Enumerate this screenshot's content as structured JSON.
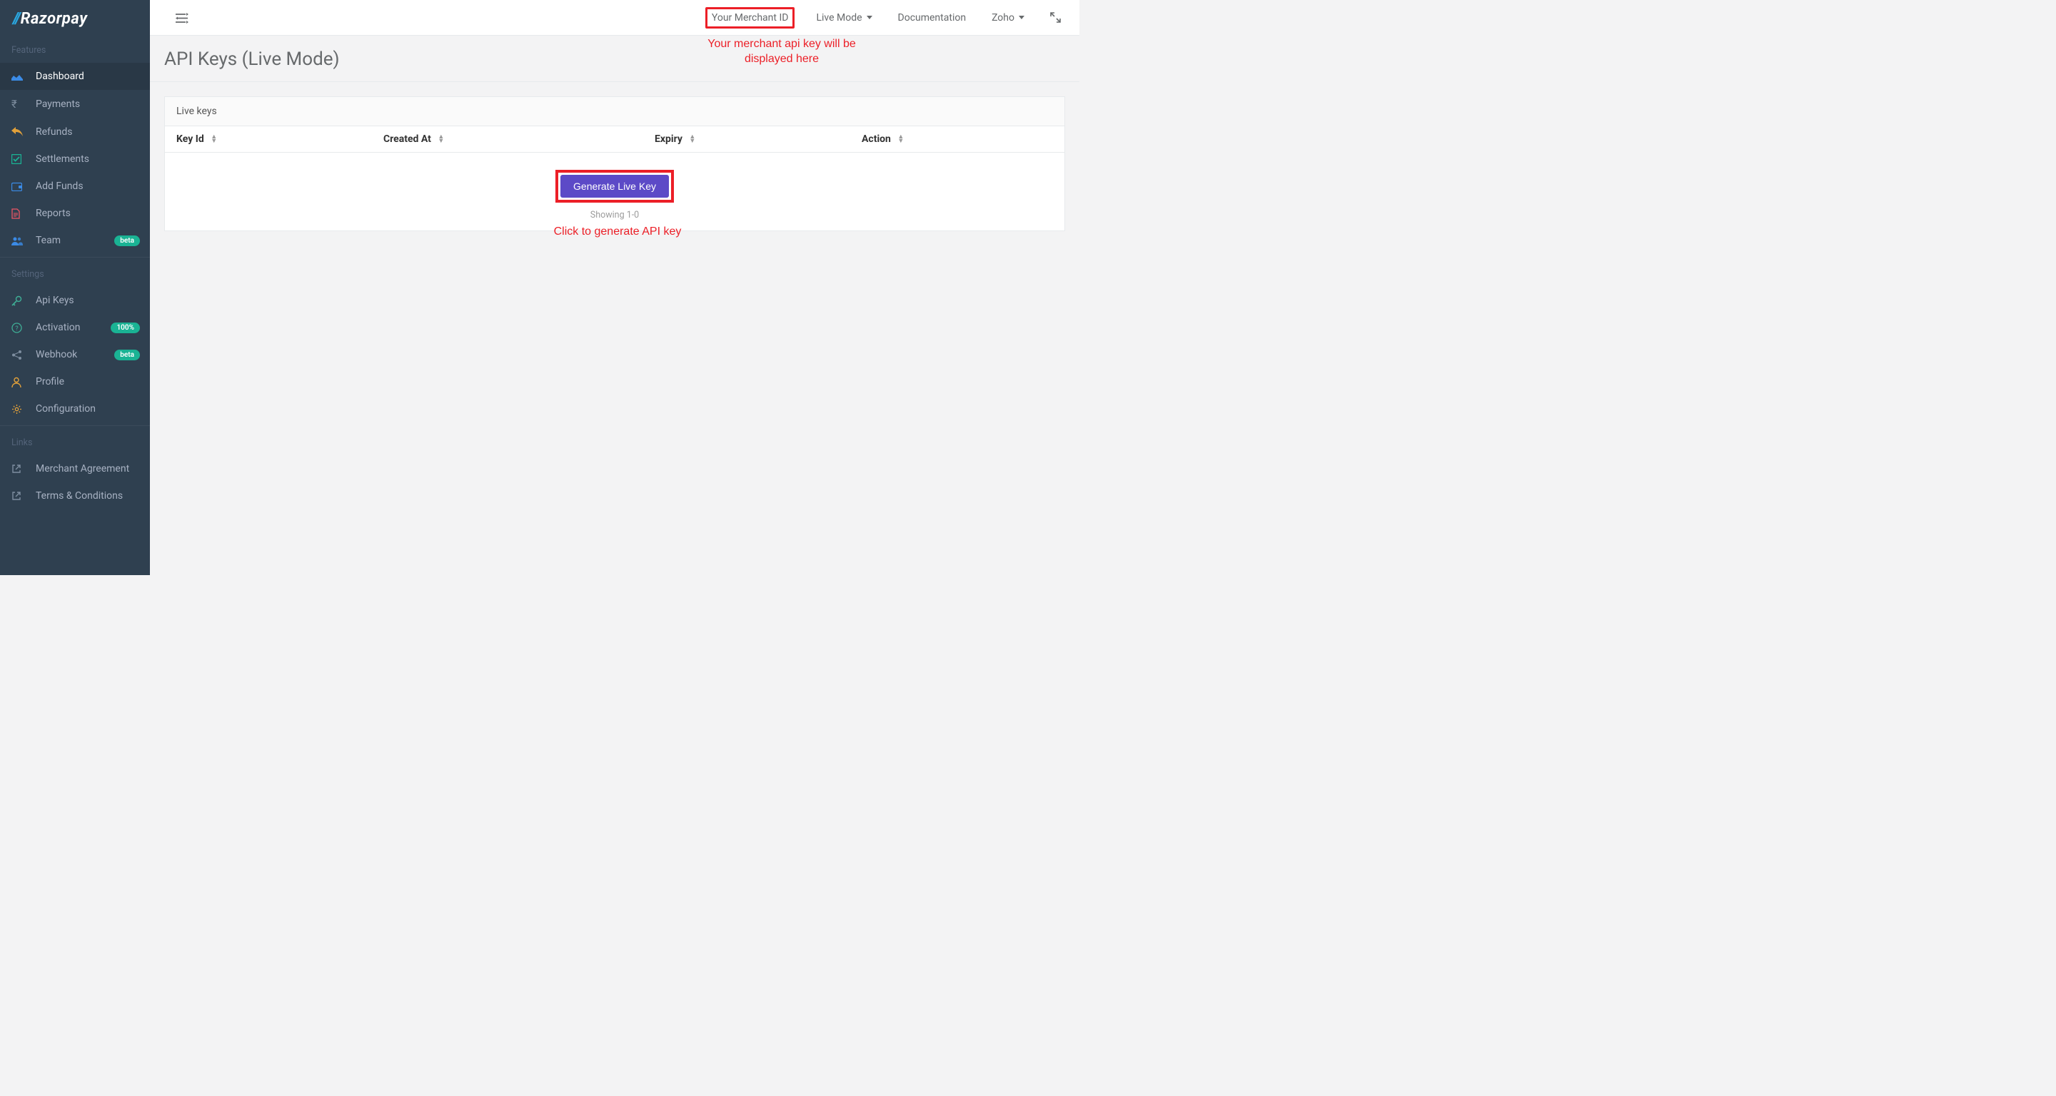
{
  "brand": {
    "slashes": "//",
    "name": "Razorpay"
  },
  "sidebar": {
    "sections": {
      "features_label": "Features",
      "settings_label": "Settings",
      "links_label": "Links"
    },
    "features": [
      {
        "label": "Dashboard"
      },
      {
        "label": "Payments"
      },
      {
        "label": "Refunds"
      },
      {
        "label": "Settlements"
      },
      {
        "label": "Add Funds"
      },
      {
        "label": "Reports"
      },
      {
        "label": "Team",
        "badge": "beta"
      }
    ],
    "settings": [
      {
        "label": "Api Keys"
      },
      {
        "label": "Activation",
        "badge": "100%"
      },
      {
        "label": "Webhook",
        "badge": "beta"
      },
      {
        "label": "Profile"
      },
      {
        "label": "Configuration"
      }
    ],
    "links": [
      {
        "label": "Merchant Agreement"
      },
      {
        "label": "Terms & Conditions"
      }
    ]
  },
  "topbar": {
    "merchant_id": "Your Merchant ID",
    "mode": "Live Mode",
    "documentation": "Documentation",
    "account": "Zoho"
  },
  "page": {
    "title": "API Keys (Live Mode)",
    "panel_title": "Live keys",
    "columns": {
      "key_id": "Key Id",
      "created_at": "Created At",
      "expiry": "Expiry",
      "action": "Action"
    },
    "generate_button": "Generate Live Key",
    "showing": "Showing 1-0",
    "rows": []
  },
  "annotations": {
    "merchant_hint": "Your merchant api key will\nbe displayed here",
    "generate_hint": "Click to generate API key"
  }
}
